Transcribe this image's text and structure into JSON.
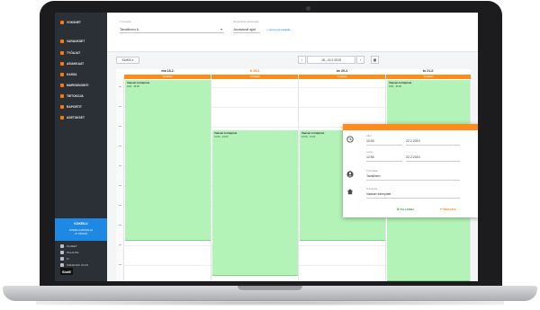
{
  "sidebar": {
    "items": [
      {
        "label": "VOKSNET",
        "icon": "app-logo-icon"
      },
      {
        "label": "VARAUKSET",
        "icon": "calendar-icon"
      },
      {
        "label": "TYÖAJAT",
        "icon": "clock-icon"
      },
      {
        "label": "ASIAKKAAT",
        "icon": "users-icon"
      },
      {
        "label": "KASSA",
        "icon": "cash-icon"
      },
      {
        "label": "MARKKINOINTI",
        "icon": "megaphone-icon"
      },
      {
        "label": "TIETOKOJA",
        "icon": "info-icon"
      },
      {
        "label": "RAPORTIT",
        "icon": "chart-icon"
      },
      {
        "label": "ASETUKSET",
        "icon": "gear-icon"
      }
    ],
    "promo": {
      "title": "KOKEILU",
      "line1": "KOKEILUJAKSOLLA",
      "line2": "27 PÄIVÄÄ"
    },
    "bottom_items": [
      {
        "label": "OHJEET",
        "icon": "help-icon"
      },
      {
        "label": "PALAUTE",
        "icon": "feedback-icon"
      },
      {
        "label": "FI",
        "icon": "globe-icon"
      },
      {
        "label": "KIRJAUDU ULOS",
        "icon": "logout-icon"
      }
    ],
    "brand": "SlotE"
  },
  "filters": {
    "employee_label": "Työntekijä",
    "employee_value": "Tavallinen k.",
    "type_label": "Näytettävät palveluajat",
    "type_value": "Joustavat ajat",
    "add_link": "+ Varaa työntekijälle"
  },
  "toolbar": {
    "kaikki": "KAIKKI",
    "prev": "‹",
    "next": "›",
    "date_range": "18 - 22.2.2019",
    "calendar_btn": "▦"
  },
  "calendar": {
    "days": [
      {
        "label": "ma 18.2.",
        "today": false
      },
      {
        "label": "ti 19.2.",
        "today": true
      },
      {
        "label": "ke 20.2.",
        "today": false
      },
      {
        "label": "to 21.2.",
        "today": false
      }
    ],
    "holiday_label": "Työaikaa",
    "events": [
      {
        "title": "Vaasan toimipiste",
        "time": "9:00 - 15:00"
      },
      {
        "title": "Vaasan toimipiste",
        "time": "10:00 - 14:00"
      },
      {
        "title": "Vaasan toimipiste",
        "time": "10:00 - 14:00"
      },
      {
        "title": "Vaasan toimipiste",
        "time": "9:00 - 15:00"
      }
    ]
  },
  "popup": {
    "start_label": "Alku",
    "start_time": "10:00",
    "start_date": "22.2.2019",
    "end_label": "Loppu",
    "end_time": "12:50",
    "end_date": "22.2.2019",
    "employee_label": "Työntekijä",
    "employee_value": "Tavallinen",
    "location_label": "Toimipiste",
    "location_value": "Vaasan toimipiste",
    "save_button": "TALLENNA",
    "cancel_button": "PERUUTA"
  },
  "colors": {
    "accent": "#ff7a00",
    "event": "#b4f3b7",
    "sidebar": "#2b2f36",
    "promo": "#1e88e5"
  }
}
